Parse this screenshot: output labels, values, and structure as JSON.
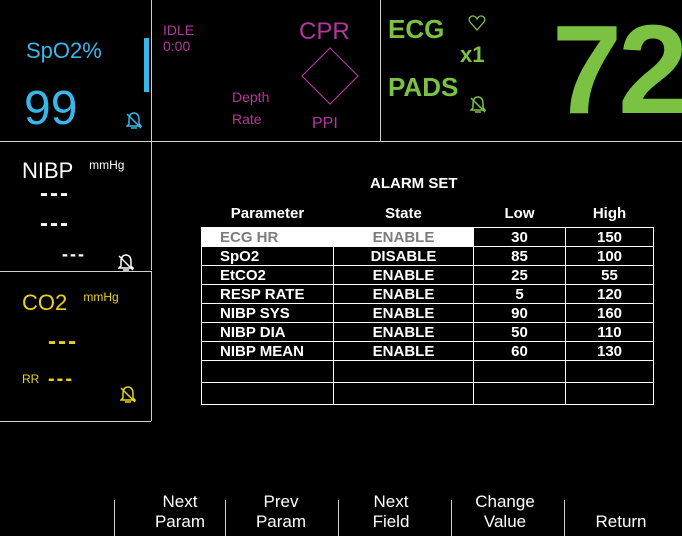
{
  "spo2": {
    "label": "SpO2%",
    "value": "99",
    "color": "#38b7ea",
    "alarm_icon": "bell-silenced-icon"
  },
  "cpr": {
    "status": "IDLE",
    "time": "0:00",
    "title": "CPR",
    "depth_label": "Depth",
    "rate_label": "Rate",
    "ppi_label": "PPI",
    "color": "#b3379b"
  },
  "ecg": {
    "lead": "ECG",
    "source": "PADS",
    "gain": "x1",
    "heart_icon": "heart-outline-icon",
    "alarm_icon": "bell-silenced-icon",
    "heart_rate": "72",
    "color": "#7bc243"
  },
  "nibp": {
    "label": "NIBP",
    "unit": "mmHg",
    "systolic": "---",
    "diastolic": "---",
    "mean": "---",
    "alarm_icon": "bell-silenced-icon"
  },
  "co2": {
    "label": "CO2",
    "unit": "mmHg",
    "value": "---",
    "rr_label": "RR",
    "rr_value": "---",
    "color": "#e8d21b",
    "alarm_icon": "bell-silenced-icon"
  },
  "alarm_table": {
    "title": "ALARM SET",
    "headers": [
      "Parameter",
      "State",
      "Low",
      "High"
    ],
    "rows": [
      {
        "parameter": "ECG HR",
        "state": "ENABLE",
        "low": "30",
        "high": "150"
      },
      {
        "parameter": "SpO2",
        "state": "DISABLE",
        "low": "85",
        "high": "100"
      },
      {
        "parameter": "EtCO2",
        "state": "ENABLE",
        "low": "25",
        "high": "55"
      },
      {
        "parameter": "RESP RATE",
        "state": "ENABLE",
        "low": "5",
        "high": "120"
      },
      {
        "parameter": "NIBP SYS",
        "state": "ENABLE",
        "low": "90",
        "high": "160"
      },
      {
        "parameter": "NIBP DIA",
        "state": "ENABLE",
        "low": "50",
        "high": "110"
      },
      {
        "parameter": "NIBP MEAN",
        "state": "ENABLE",
        "low": "60",
        "high": "130"
      }
    ]
  },
  "softkeys": {
    "next_param": [
      "Next",
      "Param"
    ],
    "prev_param": [
      "Prev",
      "Param"
    ],
    "next_field": [
      "Next",
      "Field"
    ],
    "change_value": [
      "Change",
      "Value"
    ],
    "return": "Return"
  }
}
